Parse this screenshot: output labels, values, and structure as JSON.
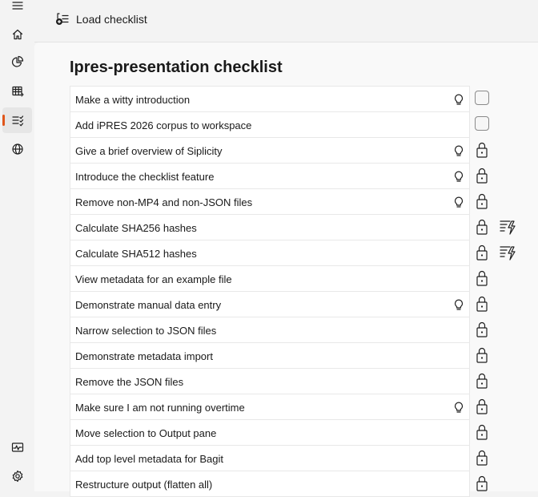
{
  "app": {
    "load_checklist_label": "Load checklist"
  },
  "rail": {
    "items": [
      {
        "name": "menu",
        "icon": "hamburger-icon"
      },
      {
        "name": "home",
        "icon": "home-icon"
      },
      {
        "name": "analytics",
        "icon": "pie-chart-icon"
      },
      {
        "name": "table",
        "icon": "table-icon"
      },
      {
        "name": "checklist",
        "icon": "checklist-icon",
        "selected": true
      },
      {
        "name": "web",
        "icon": "globe-icon"
      },
      {
        "name": "activity",
        "icon": "pulse-icon"
      },
      {
        "name": "settings",
        "icon": "gear-icon"
      }
    ],
    "accent_color": "#e0561a"
  },
  "checklist": {
    "title": "Ipres-presentation checklist",
    "items": [
      {
        "label": "Make a witty introduction",
        "hint": true,
        "state": "unchecked",
        "automation": false
      },
      {
        "label": "Add iPRES 2026 corpus to workspace",
        "hint": false,
        "state": "unchecked",
        "automation": false
      },
      {
        "label": "Give a brief overview of Siplicity",
        "hint": true,
        "state": "locked",
        "automation": false
      },
      {
        "label": "Introduce the checklist feature",
        "hint": true,
        "state": "locked",
        "automation": false
      },
      {
        "label": "Remove non-MP4 and non-JSON files",
        "hint": true,
        "state": "locked",
        "automation": false
      },
      {
        "label": "Calculate SHA256 hashes",
        "hint": false,
        "state": "locked",
        "automation": true
      },
      {
        "label": "Calculate SHA512 hashes",
        "hint": false,
        "state": "locked",
        "automation": true
      },
      {
        "label": "View metadata for an example file",
        "hint": false,
        "state": "locked",
        "automation": false
      },
      {
        "label": "Demonstrate manual data entry",
        "hint": true,
        "state": "locked",
        "automation": false
      },
      {
        "label": "Narrow selection to JSON files",
        "hint": false,
        "state": "locked",
        "automation": false
      },
      {
        "label": "Demonstrate metadata import",
        "hint": false,
        "state": "locked",
        "automation": false
      },
      {
        "label": "Remove the JSON files",
        "hint": false,
        "state": "locked",
        "automation": false
      },
      {
        "label": "Make sure I am not running overtime",
        "hint": true,
        "state": "locked",
        "automation": false
      },
      {
        "label": "Move selection to Output pane",
        "hint": false,
        "state": "locked",
        "automation": false
      },
      {
        "label": "Add top level metadata for Bagit",
        "hint": false,
        "state": "locked",
        "automation": false
      },
      {
        "label": "Restructure output (flatten all)",
        "hint": false,
        "state": "locked",
        "automation": false
      }
    ]
  }
}
